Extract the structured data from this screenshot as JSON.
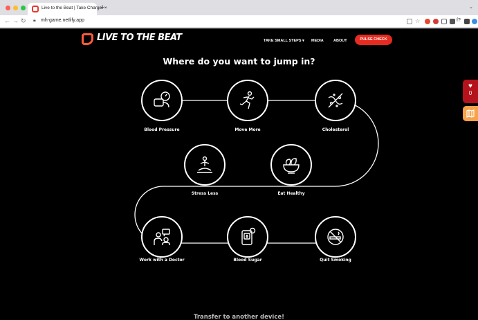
{
  "browser": {
    "tab_title": "Live to the Beat | Take Charge! ×",
    "tab_close": "×",
    "new_tab": "+",
    "url": "mh-game.netlify.app",
    "traffic_light_colors": [
      "#ff5f57",
      "#febc2e",
      "#28c840"
    ]
  },
  "site": {
    "logo_text": "LIVE TO THE BEAT",
    "nav": {
      "take_small_steps": "TAKE SMALL STEPS",
      "take_small_steps_caret": "▾",
      "media": "MEDIA",
      "about": "ABOUT",
      "pulse_check": "PULSE CHECK"
    },
    "heading": "Where do you want to jump in?",
    "nodes": [
      {
        "label": "Blood Pressure",
        "icon": "blood-pressure-monitor-icon"
      },
      {
        "label": "Move More",
        "icon": "running-person-icon"
      },
      {
        "label": "Cholesterol",
        "icon": "cholesterol-icon"
      },
      {
        "label": "Stress Less",
        "icon": "meditation-icon"
      },
      {
        "label": "Eat Healthy",
        "icon": "salad-bowl-icon"
      },
      {
        "label": "Work with a Doctor",
        "icon": "doctor-chat-icon"
      },
      {
        "label": "Blood Sugar",
        "icon": "glucose-meter-icon"
      },
      {
        "label": "Quit Smoking",
        "icon": "no-smoking-icon"
      }
    ],
    "transfer": "Transfer to another device!",
    "heart_widget_count": "0",
    "accent_color": "#e62b20"
  }
}
